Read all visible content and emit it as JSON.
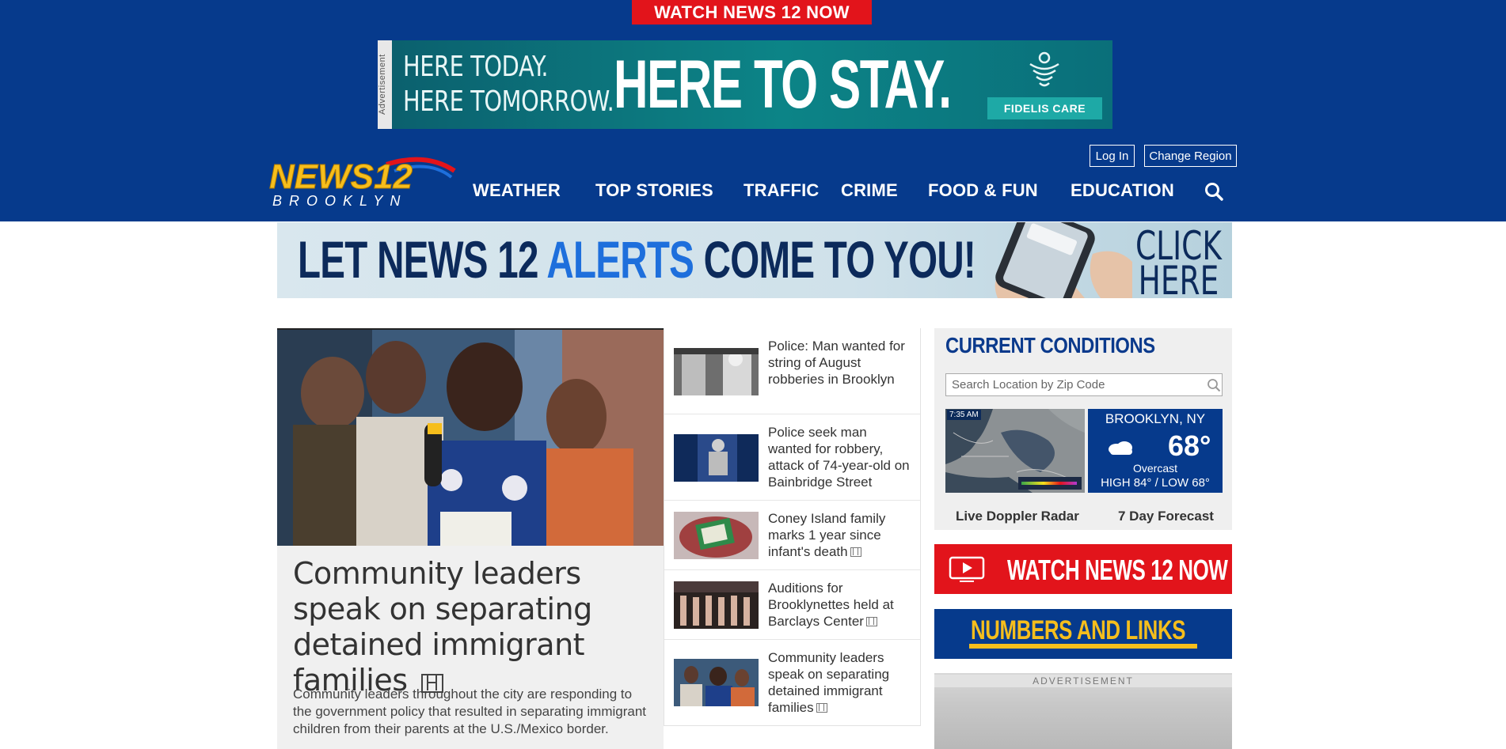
{
  "header": {
    "watch_top": "WATCH NEWS 12 NOW",
    "ad_label": "Advertisement",
    "ad_line1": "HERE TODAY.",
    "ad_line2": "HERE TOMORROW.",
    "ad_headline": "HERE TO STAY.",
    "ad_brand": "FIDELIS CARE",
    "login": "Log In",
    "change_region": "Change Region",
    "logo_news": "NEWS12",
    "logo_region": "BROOKLYN"
  },
  "nav": {
    "items": [
      "WEATHER",
      "TOP STORIES",
      "TRAFFIC",
      "CRIME",
      "FOOD & FUN",
      "EDUCATION"
    ],
    "search_icon": "search-icon"
  },
  "alerts_banner": {
    "part1": "LET NEWS 12 ",
    "part2": "ALERTS",
    "part3": " COME TO YOU!",
    "click1": "CLICK",
    "click2": "HERE"
  },
  "lead_story": {
    "headline": "Community leaders speak on separating detained immigrant families",
    "summary": "Community leaders throughout the city are responding to the government policy that resulted in separating immigrant children from their parents at the U.S./Mexico border."
  },
  "stories": [
    {
      "title": "Police: Man wanted for string of August robberies in Brooklyn",
      "video": false
    },
    {
      "title": "Police seek man wanted for robbery, attack of 74-year-old on Bainbridge Street",
      "video": false
    },
    {
      "title": "Coney Island family marks 1 year since infant's death",
      "video": true
    },
    {
      "title": "Auditions for Brooklynettes held at Barclays Center",
      "video": true
    },
    {
      "title": "Community leaders speak on separating detained immigrant families",
      "video": true
    }
  ],
  "conditions": {
    "title": "CURRENT CONDITIONS",
    "search_placeholder": "Search Location by Zip Code",
    "map_time": "7:35 AM",
    "city": "BROOKLYN, NY",
    "temp": "68°",
    "description": "Overcast",
    "hilo": "HIGH 84° / LOW 68°",
    "link_radar": "Live Doppler Radar",
    "link_forecast": "7 Day Forecast"
  },
  "sidebar": {
    "watch_label": "WATCH NEWS 12 NOW",
    "numbers_label": "NUMBERS AND LINKS",
    "ad_label": "ADVERTISEMENT"
  },
  "colors": {
    "brand_blue": "#063a8c",
    "brand_red": "#e2141b",
    "accent_yellow": "#f6be1c"
  }
}
